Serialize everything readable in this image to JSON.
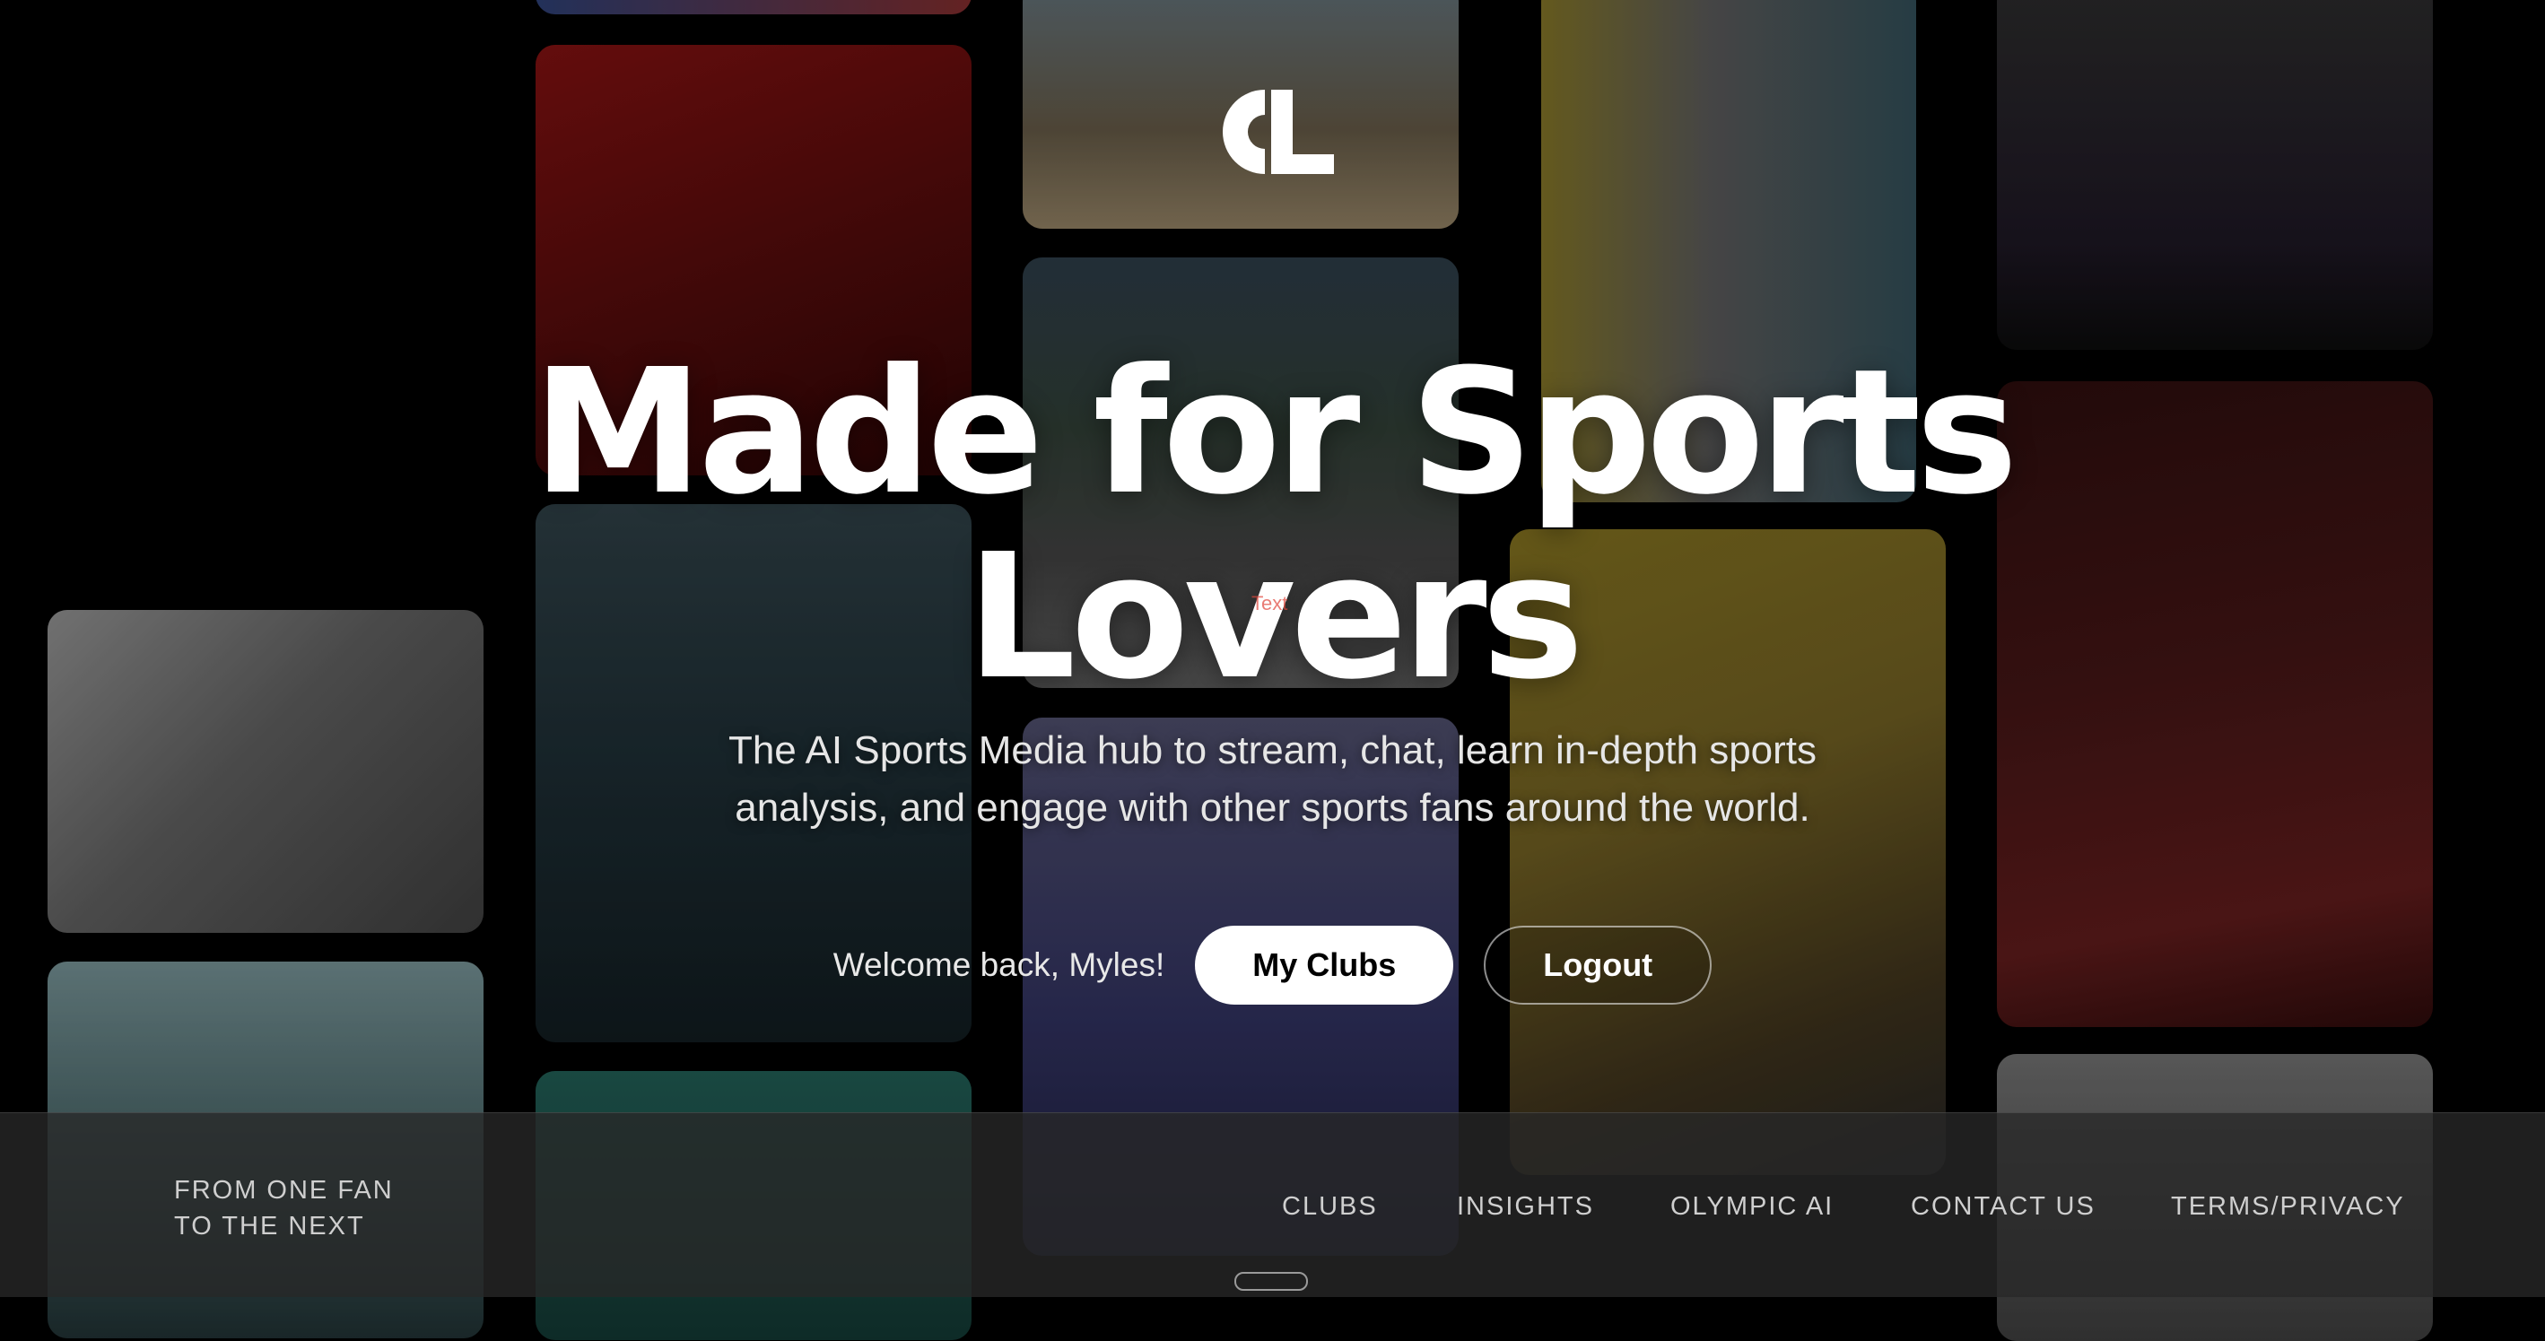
{
  "hero": {
    "headline_line1": "Made for Sports",
    "headline_line2": "Lovers",
    "tiny_label": "Text",
    "subtitle_line1": "The AI Sports Media hub to stream, chat, learn in-depth sports",
    "subtitle_line2": "analysis, and engage with other sports fans around the world."
  },
  "auth": {
    "welcome": "Welcome back, Myles!",
    "my_clubs_label": "My Clubs",
    "logout_label": "Logout"
  },
  "footer": {
    "tagline_line1": "FROM ONE FAN",
    "tagline_line2": "TO THE NEXT",
    "nav": [
      "CLUBS",
      "INSIGHTS",
      "OLYMPIC AI",
      "CONTACT US",
      "TERMS/PRIVACY"
    ]
  },
  "icons": {
    "logo": "cl-logo-icon"
  }
}
